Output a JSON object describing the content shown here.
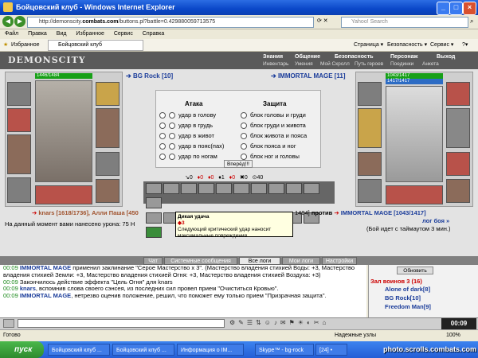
{
  "window": {
    "title": "Бойцовский клуб - Windows Internet Explorer"
  },
  "address": {
    "prefix": "http://demonscity.",
    "domain": "combats.com",
    "path": "/buttons.pl?battle=0.429880059713575"
  },
  "search": {
    "placeholder": "Yahoo! Search"
  },
  "menu": [
    "Файл",
    "Правка",
    "Вид",
    "Избранное",
    "Сервис",
    "Справка"
  ],
  "favorites": {
    "label": "Избранное",
    "tab": "Бойцовский клуб"
  },
  "ie_toolbar": [
    "Страница ▾",
    "Безопасность ▾",
    "Сервис ▾",
    "?▾"
  ],
  "game": {
    "logo": "DEMONSCITY",
    "nav_top": [
      "Знания",
      "Общение",
      "Безопасность",
      "Персонаж",
      "Выход"
    ],
    "nav_bottom": [
      "Инвентарь",
      "Умения",
      "Мой Скролл",
      "Путь героев",
      "Поединки",
      "Анкета"
    ],
    "player_left": {
      "name": "BG Rock [10]",
      "hp": "1446/1484"
    },
    "player_right": {
      "name": "IMMORTAL MAGE [11]",
      "hp": "1043/1417",
      "mp": "1417/1417"
    },
    "attack_title": "Атака",
    "defense_title": "Защита",
    "attacks": [
      "удар в голову",
      "удар в грудь",
      "удар в живот",
      "удар в пояс(пах)",
      "удар по ногам"
    ],
    "defenses": [
      "блок головы и груди",
      "блок груди и живота",
      "блок живота и пояса",
      "блок пояса и ног",
      "блок ног и головы"
    ],
    "go_button": "Вперёд!!!",
    "counters": [
      "0",
      "0",
      "0",
      "1",
      "0",
      "0",
      "40"
    ],
    "battle_line": {
      "left_names": "knars [1618/1736], Алли Паша [450",
      "right_stats": "1484]",
      "vs": "против",
      "right_name": "IMMORTAL MAGE [1043/1417]",
      "right_more": "лог боя »"
    },
    "damage_line": "На данный момент вами нанесено урона: 75 Н",
    "timeout_line": "(Бой идет с таймаутом 3 мин.)",
    "tooltip": {
      "title": "Дикая удача",
      "count": "3",
      "text": "Следующий критический удар наносит максимальные повреждения"
    }
  },
  "chat_tabs": [
    "Чат",
    "Системные сообщения",
    "Все логи",
    "Мои логи",
    "Настройки"
  ],
  "chat_lines": [
    {
      "time": "00:09",
      "who": "IMMORTAL MAGE",
      "text": " применил заклинание \"Серое Мастерство x 3\". (Мастерство владения стихией Воды: +3, Мастерство владения стихией Земли: +3, Мастерство владения стихией Огня: +3, Мастерство владения стихией Воздуха: +3)"
    },
    {
      "time": "00:09",
      "who": "",
      "text": "Закончилось действие эффекта \"Цель Огня\" для knars"
    },
    {
      "time": "00:09",
      "who": "knars",
      "text": ", вспомнив слова своего сэнсея, из последних сил провел прием \"Очиститься Кровью\"."
    },
    {
      "time": "00:09",
      "who": "IMMORTAL MAGE",
      "text": ", нетрезво оценив положение, решил, что поможет ему только прием \"Призрачная защита\"."
    }
  ],
  "roomlist": {
    "refresh": "Обновить",
    "title": "Зал воинов 3 (16)",
    "users": [
      "Alone of dark[8]",
      "BG Rock[10]",
      "Freedom Man[9]"
    ]
  },
  "clock": "00:09",
  "statusbar": {
    "left": "Готово",
    "zone": "Надежные узлы",
    "zoom": "100%"
  },
  "taskbar": {
    "start": "пуск",
    "tasks": [
      "Бойцовский клуб ...",
      "Бойцовский клуб ...",
      "Информация о IM...",
      "Skype™ - bg-rock",
      "[24] •"
    ],
    "watermark": "photo.scrolls.combats.com"
  }
}
